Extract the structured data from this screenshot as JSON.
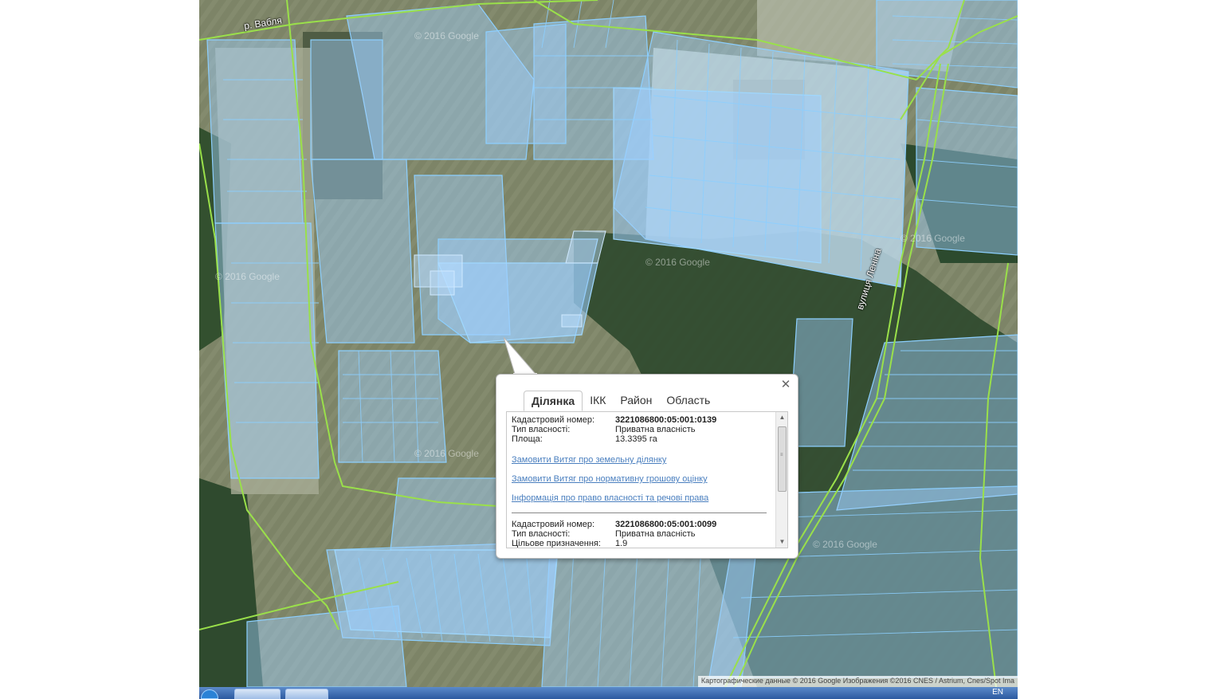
{
  "map": {
    "labels": {
      "river": "р. Вабля",
      "street": "вулиця Леніна"
    },
    "watermark": "© 2016 Google",
    "attribution": "Картографические данные © 2016 Google Изображения ©2016 CNES / Astrium, Cnes/Spot Ima",
    "colors": {
      "parcel_fill": "#9fd0ff",
      "parcel_stroke": "#8ccfff",
      "boundary": "#9ae04a",
      "forest": "#2f4a2e",
      "field": "#8a8f6c"
    }
  },
  "popup": {
    "close_icon": "close-icon",
    "tabs": [
      {
        "label": "Ділянка",
        "active": true
      },
      {
        "label": "ІКК",
        "active": false
      },
      {
        "label": "Район",
        "active": false
      },
      {
        "label": "Область",
        "active": false
      }
    ],
    "parcel1": {
      "cadastral_label": "Кадастровий номер:",
      "cadastral_value": "3221086800:05:001:0139",
      "ownership_label": "Тип власності:",
      "ownership_value": "Приватна власність",
      "area_label": "Площа:",
      "area_value": "13.3395 га"
    },
    "links": [
      "Замовити Витяг про земельну ділянку",
      "Замовити Витяг про нормативну грошову оцінку",
      "Інформація про право власності та речові права"
    ],
    "parcel2": {
      "cadastral_label": "Кадастровий номер:",
      "cadastral_value": "3221086800:05:001:0099",
      "ownership_label": "Тип власності:",
      "ownership_value": "Приватна власність",
      "purpose_label": "Цільове призначення:",
      "purpose_value": "1.9"
    }
  },
  "taskbar": {
    "lang": "EN"
  }
}
